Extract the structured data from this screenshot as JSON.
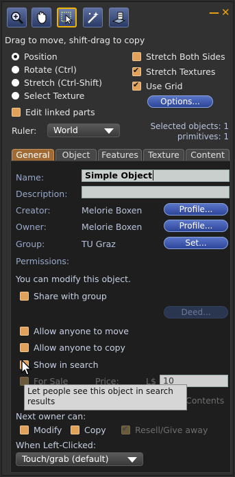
{
  "toolbar": {
    "tools": [
      "zoom-icon",
      "grab-hand-icon",
      "select-cursor-icon",
      "magic-wand-icon",
      "land-icon"
    ],
    "minimize_glyph": "—",
    "close_glyph": "✕"
  },
  "hint": "Drag to move, shift-drag to copy",
  "edit_modes": [
    {
      "label": "Position",
      "selected": true
    },
    {
      "label": "Rotate (Ctrl)",
      "selected": false
    },
    {
      "label": "Stretch (Ctrl-Shift)",
      "selected": false
    },
    {
      "label": "Select Texture",
      "selected": false
    }
  ],
  "edit_linked": {
    "label": "Edit linked parts",
    "checked": false
  },
  "options": {
    "stretch_both": {
      "label": "Stretch Both Sides",
      "checked": false
    },
    "stretch_textures": {
      "label": "Stretch Textures",
      "checked": true
    },
    "use_grid": {
      "label": "Use Grid",
      "checked": true
    },
    "options_button": "Options..."
  },
  "ruler": {
    "label": "Ruler:",
    "value": "World"
  },
  "selection": {
    "objects": "Selected objects: 1",
    "primitives": "primitives: 1"
  },
  "tabs": [
    "General",
    "Object",
    "Features",
    "Texture",
    "Content"
  ],
  "general": {
    "name_label": "Name:",
    "name_value": "Simple Object",
    "description_label": "Description:",
    "description_value": "",
    "creator_label": "Creator:",
    "creator_value": "Melorie Boxen",
    "owner_label": "Owner:",
    "owner_value": "Melorie Boxen",
    "group_label": "Group:",
    "group_value": "TU Graz",
    "profile_button": "Profile...",
    "set_button": "Set...",
    "permissions_label": "Permissions:",
    "permissions_text": "You can modify this object.",
    "share_with_group": "Share with group",
    "deed_button": "Deed...",
    "allow_move": "Allow anyone to move",
    "allow_copy": "Allow anyone to copy",
    "show_in_search": "Show in search",
    "for_sale": "For Sale",
    "price_label": "Price:",
    "currency": "L$",
    "price_value": "10",
    "contents_label": "Contents",
    "tooltip": "Let people see this object in search results",
    "next_owner_label": "Next owner can:",
    "modify": {
      "label": "Modify",
      "checked": false
    },
    "copy": {
      "label": "Copy",
      "checked": false
    },
    "resell": {
      "label": "Resell/Give away",
      "checked": true
    },
    "left_click_label": "When Left-Clicked:",
    "left_click_value": "Touch/grab (default)"
  }
}
